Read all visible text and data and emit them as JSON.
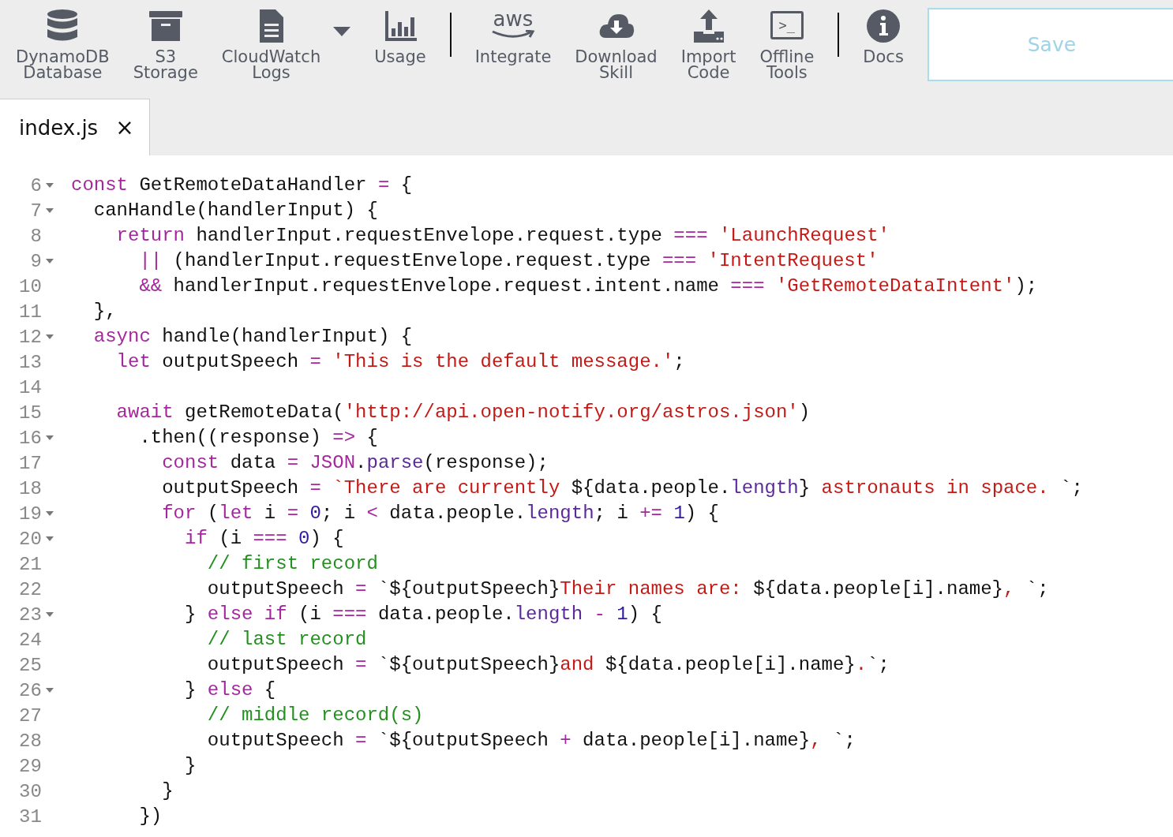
{
  "toolbar": {
    "groups": [
      [
        {
          "label": "DynamoDB\nDatabase",
          "dropdown": false
        },
        {
          "label": "S3\nStorage",
          "dropdown": false
        },
        {
          "label": "CloudWatch\nLogs",
          "dropdown": true
        },
        {
          "label": "Usage",
          "dropdown": false
        }
      ],
      [
        {
          "label": "Integrate",
          "icon_text": "aws",
          "dropdown": false
        },
        {
          "label": "Download\nSkill",
          "dropdown": false
        },
        {
          "label": "Import\nCode",
          "dropdown": false
        },
        {
          "label": "Offline\nTools",
          "icon_text": ">_",
          "dropdown": false
        }
      ],
      [
        {
          "label": "Docs",
          "dropdown": false
        }
      ]
    ],
    "save_button": {
      "label": "Save",
      "disabled": true
    }
  },
  "tabs": [
    {
      "label": "index.js",
      "close": "×",
      "selected": true
    }
  ],
  "editor": {
    "lines": [
      {
        "number": "6",
        "foldable": true,
        "tokens": [
          {
            "kind": "keyword",
            "text": "const"
          },
          {
            "kind": "plain",
            "text": " GetRemoteDataHandler "
          },
          {
            "kind": "keyword",
            "text": "="
          },
          {
            "kind": "plain",
            "text": " {"
          }
        ]
      },
      {
        "number": "7",
        "foldable": true,
        "tokens": [
          {
            "kind": "plain",
            "text": "  canHandle(handlerInput) {"
          }
        ]
      },
      {
        "number": "8",
        "foldable": false,
        "tokens": [
          {
            "kind": "keyword",
            "text": "    return"
          },
          {
            "kind": "plain",
            "text": " handlerInput.requestEnvelope.request.type "
          },
          {
            "kind": "keyword",
            "text": "=== "
          },
          {
            "kind": "string",
            "text": "'LaunchRequest'"
          }
        ]
      },
      {
        "number": "9",
        "foldable": true,
        "tokens": [
          {
            "kind": "keyword",
            "text": "      ||"
          },
          {
            "kind": "plain",
            "text": " (handlerInput.requestEnvelope.request.type "
          },
          {
            "kind": "keyword",
            "text": "=== "
          },
          {
            "kind": "string",
            "text": "'IntentRequest'"
          }
        ]
      },
      {
        "number": "10",
        "foldable": false,
        "tokens": [
          {
            "kind": "keyword",
            "text": "      &&"
          },
          {
            "kind": "plain",
            "text": " handlerInput.requestEnvelope.request.intent.name "
          },
          {
            "kind": "keyword",
            "text": "=== "
          },
          {
            "kind": "string",
            "text": "'GetRemoteDataIntent'"
          },
          {
            "kind": "plain",
            "text": ");"
          }
        ]
      },
      {
        "number": "11",
        "foldable": false,
        "tokens": [
          {
            "kind": "plain",
            "text": "  },"
          }
        ]
      },
      {
        "number": "12",
        "foldable": true,
        "tokens": [
          {
            "kind": "keyword",
            "text": "  async"
          },
          {
            "kind": "plain",
            "text": " handle(handlerInput) {"
          }
        ]
      },
      {
        "number": "13",
        "foldable": false,
        "tokens": [
          {
            "kind": "keyword",
            "text": "    let"
          },
          {
            "kind": "plain",
            "text": " outputSpeech "
          },
          {
            "kind": "keyword",
            "text": "= "
          },
          {
            "kind": "string",
            "text": "'This is the default message.'"
          },
          {
            "kind": "plain",
            "text": ";"
          }
        ]
      },
      {
        "number": "14",
        "foldable": false
      },
      {
        "number": "15",
        "foldable": false,
        "tokens": [
          {
            "kind": "keyword",
            "text": "    await"
          },
          {
            "kind": "plain",
            "text": " getRemoteData("
          },
          {
            "kind": "string",
            "text": "'http://api.open-notify.org/astros.json'"
          },
          {
            "kind": "plain",
            "text": ")"
          }
        ]
      },
      {
        "number": "16",
        "foldable": true,
        "tokens": [
          {
            "kind": "plain",
            "text": "      .then((response) "
          },
          {
            "kind": "keyword",
            "text": "=>"
          },
          {
            "kind": "plain",
            "text": " {"
          }
        ]
      },
      {
        "number": "17",
        "foldable": false,
        "tokens": [
          {
            "kind": "keyword",
            "text": "        const"
          },
          {
            "kind": "plain",
            "text": " data "
          },
          {
            "kind": "keyword",
            "text": "= JSON"
          },
          {
            "kind": "plain",
            "text": "."
          },
          {
            "kind": "builtin",
            "text": "parse"
          },
          {
            "kind": "plain",
            "text": "(response);"
          }
        ]
      },
      {
        "number": "18",
        "foldable": false,
        "tokens": [
          {
            "kind": "plain",
            "text": "        outputSpeech "
          },
          {
            "kind": "keyword",
            "text": "= "
          },
          {
            "kind": "string",
            "text": "`There are currently "
          },
          {
            "kind": "plain",
            "text": "${data.people."
          },
          {
            "kind": "builtin",
            "text": "length"
          },
          {
            "kind": "plain",
            "text": "}"
          },
          {
            "kind": "string",
            "text": " astronauts in space. "
          },
          {
            "kind": "plain",
            "text": "`;"
          }
        ]
      },
      {
        "number": "19",
        "foldable": true,
        "tokens": [
          {
            "kind": "keyword",
            "text": "        for"
          },
          {
            "kind": "plain",
            "text": " ("
          },
          {
            "kind": "keyword",
            "text": "let"
          },
          {
            "kind": "plain",
            "text": " i "
          },
          {
            "kind": "keyword",
            "text": "= "
          },
          {
            "kind": "number",
            "text": "0"
          },
          {
            "kind": "plain",
            "text": "; i "
          },
          {
            "kind": "keyword",
            "text": "<"
          },
          {
            "kind": "plain",
            "text": " data.people."
          },
          {
            "kind": "builtin",
            "text": "length"
          },
          {
            "kind": "plain",
            "text": "; i "
          },
          {
            "kind": "keyword",
            "text": "+= "
          },
          {
            "kind": "number",
            "text": "1"
          },
          {
            "kind": "plain",
            "text": ") {"
          }
        ]
      },
      {
        "number": "20",
        "foldable": true,
        "tokens": [
          {
            "kind": "keyword",
            "text": "          if"
          },
          {
            "kind": "plain",
            "text": " (i "
          },
          {
            "kind": "keyword",
            "text": "=== "
          },
          {
            "kind": "number",
            "text": "0"
          },
          {
            "kind": "plain",
            "text": ") {"
          }
        ]
      },
      {
        "number": "21",
        "foldable": false,
        "tokens": [
          {
            "kind": "comment",
            "text": "            // first record"
          }
        ]
      },
      {
        "number": "22",
        "foldable": false,
        "tokens": [
          {
            "kind": "plain",
            "text": "            outputSpeech "
          },
          {
            "kind": "keyword",
            "text": "="
          },
          {
            "kind": "plain",
            "text": " `${outputSpeech}"
          },
          {
            "kind": "string",
            "text": "Their names are: "
          },
          {
            "kind": "plain",
            "text": "${data.people[i].name}"
          },
          {
            "kind": "string",
            "text": ", "
          },
          {
            "kind": "plain",
            "text": "`;"
          }
        ]
      },
      {
        "number": "23",
        "foldable": true,
        "tokens": [
          {
            "kind": "plain",
            "text": "          } "
          },
          {
            "kind": "keyword",
            "text": "else if"
          },
          {
            "kind": "plain",
            "text": " (i "
          },
          {
            "kind": "keyword",
            "text": "==="
          },
          {
            "kind": "plain",
            "text": " data.people."
          },
          {
            "kind": "builtin",
            "text": "length "
          },
          {
            "kind": "keyword",
            "text": "- "
          },
          {
            "kind": "number",
            "text": "1"
          },
          {
            "kind": "plain",
            "text": ") {"
          }
        ]
      },
      {
        "number": "24",
        "foldable": false,
        "tokens": [
          {
            "kind": "comment",
            "text": "            // last record"
          }
        ]
      },
      {
        "number": "25",
        "foldable": false,
        "tokens": [
          {
            "kind": "plain",
            "text": "            outputSpeech "
          },
          {
            "kind": "keyword",
            "text": "="
          },
          {
            "kind": "plain",
            "text": " `${outputSpeech}"
          },
          {
            "kind": "string",
            "text": "and "
          },
          {
            "kind": "plain",
            "text": "${data.people[i].name}"
          },
          {
            "kind": "string",
            "text": "."
          },
          {
            "kind": "plain",
            "text": "`;"
          }
        ]
      },
      {
        "number": "26",
        "foldable": true,
        "tokens": [
          {
            "kind": "plain",
            "text": "          } "
          },
          {
            "kind": "keyword",
            "text": "else"
          },
          {
            "kind": "plain",
            "text": " {"
          }
        ]
      },
      {
        "number": "27",
        "foldable": false,
        "tokens": [
          {
            "kind": "comment",
            "text": "            // middle record(s)"
          }
        ]
      },
      {
        "number": "28",
        "foldable": false,
        "tokens": [
          {
            "kind": "plain",
            "text": "            outputSpeech "
          },
          {
            "kind": "keyword",
            "text": "="
          },
          {
            "kind": "plain",
            "text": " `${outputSpeech "
          },
          {
            "kind": "keyword",
            "text": "+"
          },
          {
            "kind": "plain",
            "text": " data.people[i].name}"
          },
          {
            "kind": "string",
            "text": ", "
          },
          {
            "kind": "plain",
            "text": "`;"
          }
        ]
      },
      {
        "number": "29",
        "foldable": false,
        "tokens": [
          {
            "kind": "plain",
            "text": "          }"
          }
        ]
      },
      {
        "number": "30",
        "foldable": false,
        "tokens": [
          {
            "kind": "plain",
            "text": "        }"
          }
        ]
      },
      {
        "number": "31",
        "foldable": false,
        "tokens": [
          {
            "kind": "plain",
            "text": "      })"
          }
        ]
      }
    ]
  }
}
